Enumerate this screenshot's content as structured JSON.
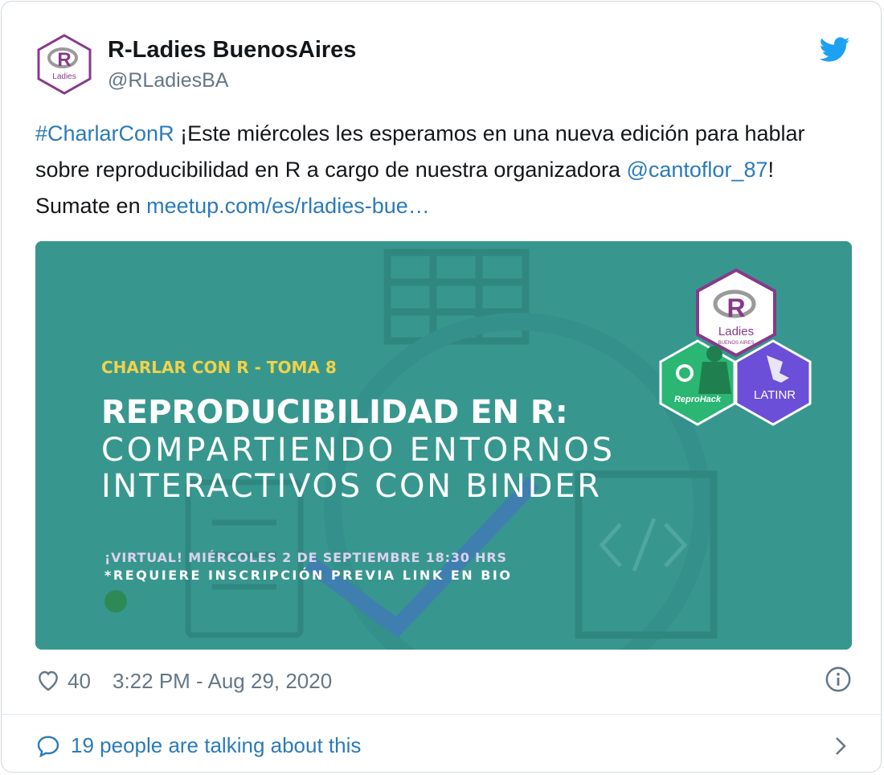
{
  "account": {
    "name": "R-Ladies BuenosAires",
    "handle": "@RLadiesBA"
  },
  "tweet": {
    "hashtag": "#CharlarConR",
    "text1": " ¡Este miércoles les esperamos en una nueva edición para hablar sobre reproducibilidad en R a cargo de nuestra organizadora ",
    "mention": "@cantoflor_87",
    "text2": "! Sumate en ",
    "url": "meetup.com/es/rladies-bue…"
  },
  "media": {
    "kicker": "CHARLAR CON R - TOMA 8",
    "title": "REPRODUCIBILIDAD EN R:",
    "subtitle_line1": "COMPARTIENDO ENTORNOS",
    "subtitle_line2": "INTERACTIVOS CON BINDER",
    "detail1": "¡VIRTUAL! MIÉRCOLES 2 DE SEPTIEMBRE 18:30 HRS",
    "detail2": "*REQUIERE INSCRIPCIÓN PREVIA LINK EN BIO",
    "logo_rladies_text": "Ladies",
    "logo_rladies_sub": "BUENOS AIRES",
    "logo_reprohack": "ReproHack",
    "logo_latinr": "LATINR",
    "colors": {
      "background": "#37978f",
      "kicker": "#f2d249",
      "hex_purple": "#88398a",
      "latinr": "#6b4fd8",
      "reprohack": "#2bb673"
    }
  },
  "footer": {
    "likes": "40",
    "timestamp": "3:22 PM - Aug 29, 2020"
  },
  "conversation": {
    "label": "19 people are talking about this"
  },
  "icons": [
    "twitter-bird-icon",
    "heart-icon",
    "info-icon",
    "speech-bubble-icon",
    "chevron-right-icon"
  ]
}
